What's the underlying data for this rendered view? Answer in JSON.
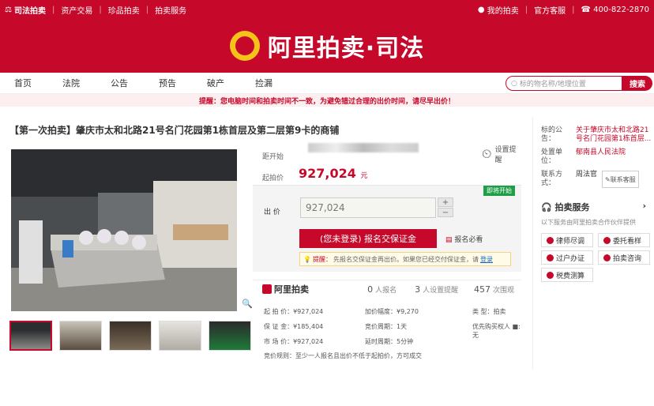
{
  "topbar": {
    "logo": "司法拍卖",
    "links": [
      "资产交易",
      "珍品拍卖",
      "拍卖服务"
    ],
    "my_auction": "我的拍卖",
    "service": "官方客服",
    "phone": "400-822-2870"
  },
  "header": {
    "brand": "阿里拍卖·司法"
  },
  "nav": {
    "items": [
      "首页",
      "法院",
      "公告",
      "预告",
      "破产",
      "捡漏"
    ],
    "search_placeholder": "标的物名称/地理位置",
    "search_button": "搜索"
  },
  "notice": "提醒：您电脑时间和拍卖时间不一致，为避免错过合理的出价时间，请尽早出价！",
  "item": {
    "title": "【第一次拍卖】肇庆市太和北路21号名门花园第1栋首层及第二层第9卡的商铺",
    "start_label": "距开始",
    "start_price_label": "起拍价",
    "start_price": "927,024",
    "unit": "元",
    "remind": "设置提醒",
    "tag": "即将开始",
    "bid_label": "出  价",
    "bid_value": "927,024",
    "apply_button": "(您未登录) 报名交保证金",
    "must_read": "报名必看",
    "tip_prefix": "提醒：",
    "tip_text": "先报名交保证金再出价。如果您已经交付保证金，请",
    "tip_login": "登录"
  },
  "stats": {
    "logo": "阿里拍卖",
    "signup_num": "0",
    "signup_label": "人报名",
    "remind_num": "3",
    "remind_label": "人设置提醒",
    "view_num": "457",
    "view_label": "次围观"
  },
  "details": {
    "start_price": "起 拍 价：¥927,024",
    "increment": "加价幅度：¥9,270",
    "type_label": "类     型：",
    "type_value": "拍卖",
    "deposit": "保 证 金：¥185,404",
    "period": "竞价周期：1天",
    "priority_label": "优先购买权人",
    "priority_value": "无",
    "market": "市 场 价：¥927,024",
    "delay": "延时周期：5分钟",
    "rule": "竞价规则：至少一人报名且出价不低于起拍价，方可成交"
  },
  "sidebar": {
    "notice_label": "标的公告：",
    "notice_value": "关于肇庆市太和北路21号名门花园第1栋首层...",
    "unit_label": "处置单位：",
    "unit_value": "郁南县人民法院",
    "contact_label": "联系方式：",
    "contact_value": "周法官",
    "kefu": "联系客服",
    "service_title": "拍卖服务",
    "service_desc": "以下服务由阿里拍卖合作伙伴提供",
    "services": [
      "律师尽调",
      "委托看样",
      "过户办证",
      "拍卖咨询",
      "税费测算"
    ]
  }
}
